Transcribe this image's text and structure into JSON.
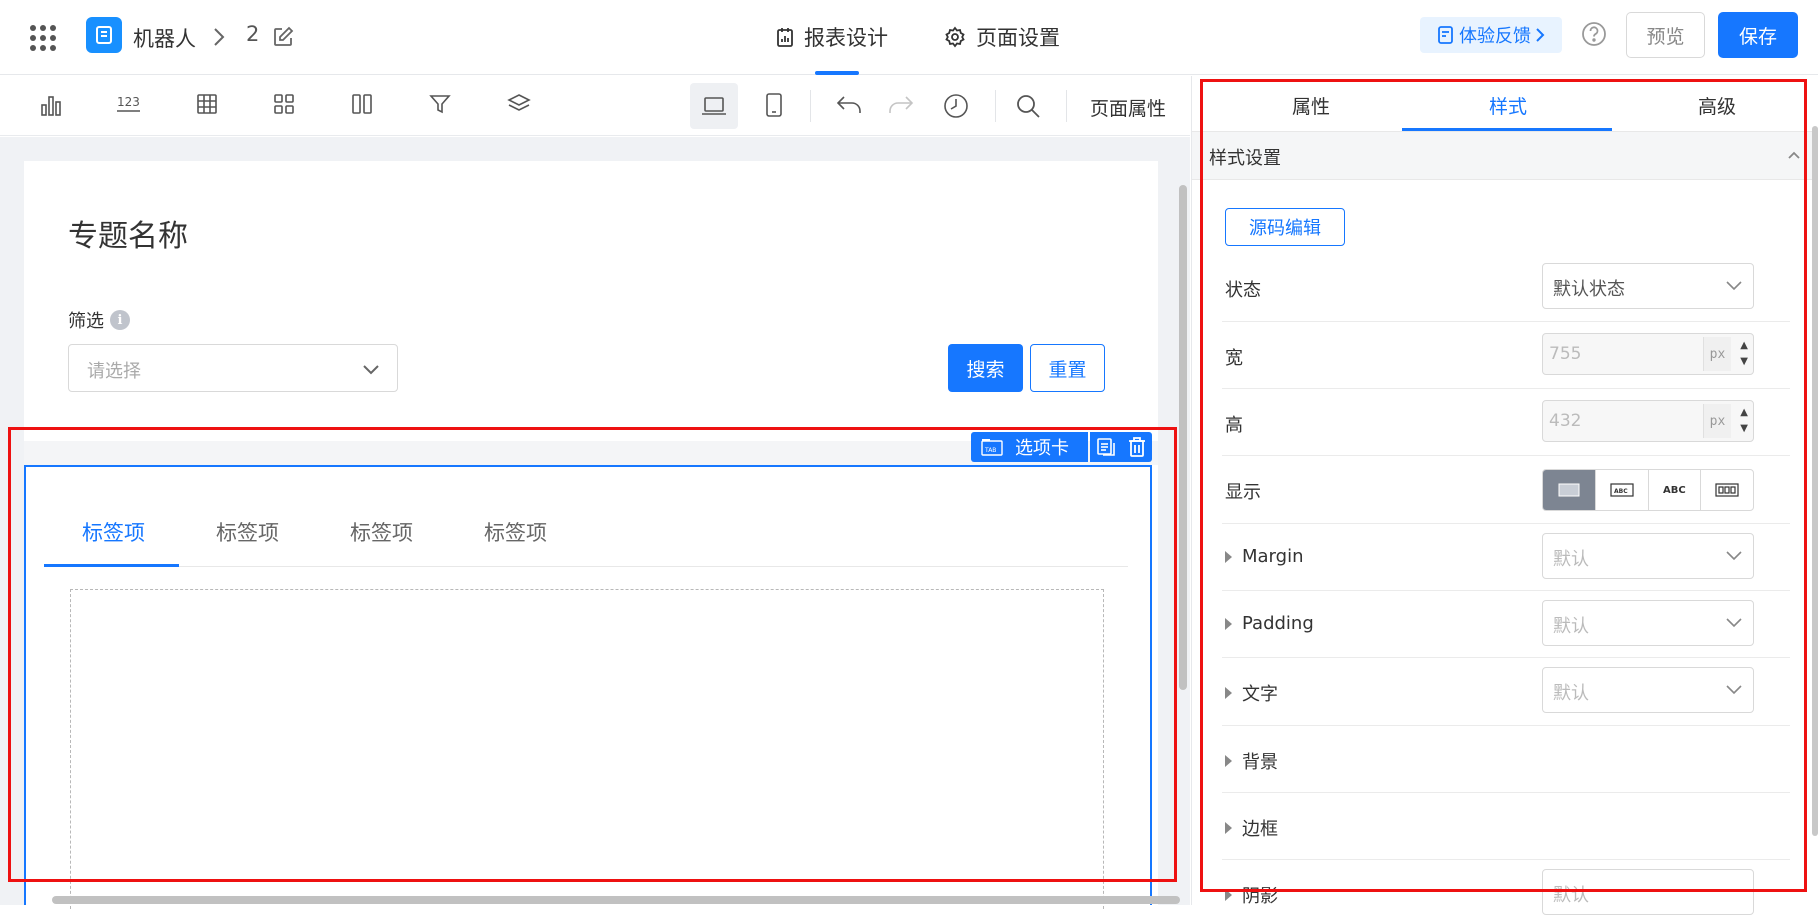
{
  "header": {
    "breadcrumb_app": "机器人",
    "breadcrumb_page": "2",
    "tab_report_design": "报表设计",
    "tab_page_settings": "页面设置",
    "feedback_label": "体验反馈",
    "preview_label": "预览",
    "save_label": "保存"
  },
  "toolbar": {
    "page_properties_label": "页面属性",
    "icons": [
      "bar-chart-icon",
      "number-card-icon",
      "table-icon",
      "grid-layout-icon",
      "columns-icon",
      "filter-icon",
      "layers-icon",
      "laptop-icon",
      "mobile-icon",
      "undo-icon",
      "redo-icon",
      "history-icon",
      "search-icon"
    ]
  },
  "canvas": {
    "page_title": "专题名称",
    "filter_label": "筛选",
    "filter_info": "i",
    "filter_placeholder": "请选择",
    "search_button": "搜索",
    "reset_button": "重置",
    "component_tag": "选项卡",
    "component_tag_icon_text": "TAB",
    "tabs": [
      "标签项",
      "标签项",
      "标签项",
      "标签项"
    ],
    "active_tab_index": 0
  },
  "panel": {
    "tabs": [
      "属性",
      "样式",
      "高级"
    ],
    "active_tab": "样式",
    "section_title": "样式设置",
    "source_edit_button": "源码编辑",
    "state_label": "状态",
    "state_value": "默认状态",
    "width_label": "宽",
    "width_value": "755",
    "height_label": "高",
    "height_value": "432",
    "unit": "px",
    "display_label": "显示",
    "display_options": [
      "block",
      "ABC-box",
      "ABC",
      "inline-blocks"
    ],
    "display_option_text_2": "ABC",
    "display_option_text_3": "ABC",
    "margin_label": "Margin",
    "margin_value": "默认",
    "padding_label": "Padding",
    "padding_value": "默认",
    "text_label": "文字",
    "text_value": "默认",
    "background_label": "背景",
    "border_label": "边框",
    "shadow_label": "阴影",
    "shadow_value": "默认"
  },
  "colors": {
    "accent": "#1677ff",
    "annotation": "#ee1111",
    "canvas_bg": "#f0f2f5"
  }
}
